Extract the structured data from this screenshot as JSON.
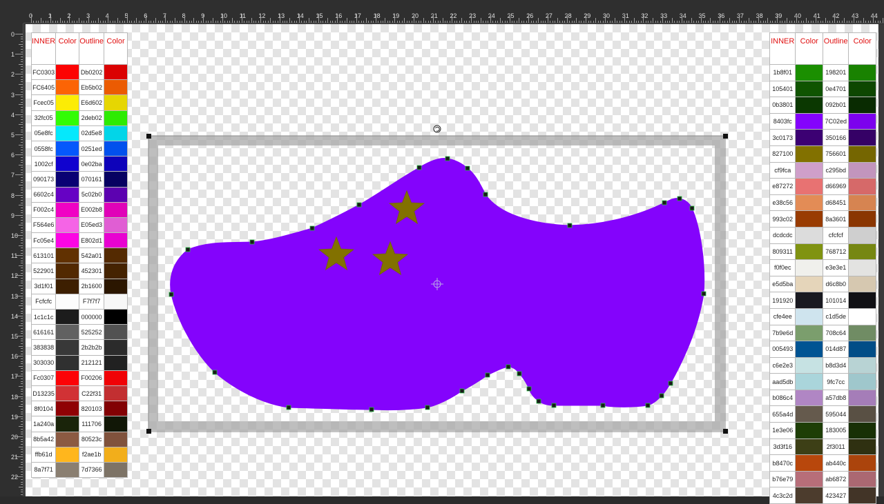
{
  "ruler": {
    "top_labels": [
      "0",
      "1",
      "2",
      "3",
      "4",
      "5",
      "6",
      "7",
      "8",
      "9",
      "10",
      "11",
      "12",
      "13",
      "14",
      "15",
      "16",
      "17",
      "18",
      "19",
      "20",
      "21",
      "22",
      "23",
      "24",
      "25",
      "26",
      "27",
      "28",
      "29",
      "30",
      "31",
      "32",
      "33",
      "34",
      "35",
      "36",
      "37",
      "38",
      "39",
      "40",
      "41",
      "42",
      "43",
      "44"
    ],
    "left_labels": [
      "0",
      "1",
      "2",
      "3",
      "4",
      "5",
      "6",
      "7",
      "8",
      "9",
      "10",
      "11",
      "12",
      "13",
      "14",
      "15",
      "16",
      "17",
      "18",
      "19",
      "20",
      "21",
      "22"
    ]
  },
  "palette_left": {
    "headers": [
      "INNER",
      "Color",
      "Outline",
      "Color"
    ],
    "rows": [
      {
        "inner": "FC0303",
        "inner_color": "#fc0303",
        "outline": "Db0202",
        "outline_color": "#db0202"
      },
      {
        "inner": "FC6405",
        "inner_color": "#fc6405",
        "outline": "Eb5b02",
        "outline_color": "#eb5b02"
      },
      {
        "inner": "Fcec05",
        "inner_color": "#fcec05",
        "outline": "E6d602",
        "outline_color": "#e6d602"
      },
      {
        "inner": "32fc05",
        "inner_color": "#32fc05",
        "outline": "2deb02",
        "outline_color": "#2deb02"
      },
      {
        "inner": "05e8fc",
        "inner_color": "#05e8fc",
        "outline": "02d5e8",
        "outline_color": "#02d5e8"
      },
      {
        "inner": "0558fc",
        "inner_color": "#0558fc",
        "outline": "0251ed",
        "outline_color": "#0251ed"
      },
      {
        "inner": "1002cf",
        "inner_color": "#1002cf",
        "outline": "0e02ba",
        "outline_color": "#0e02ba"
      },
      {
        "inner": "090173",
        "inner_color": "#090173",
        "outline": "070161",
        "outline_color": "#070161"
      },
      {
        "inner": "6602c4",
        "inner_color": "#6602c4",
        "outline": "5c02b0",
        "outline_color": "#5c02b0"
      },
      {
        "inner": "F002c4",
        "inner_color": "#f002c4",
        "outline": "E002b8",
        "outline_color": "#e002b8"
      },
      {
        "inner": "F564e6",
        "inner_color": "#f564e6",
        "outline": "E05ed3",
        "outline_color": "#e05ed3"
      },
      {
        "inner": "Fc05e4",
        "inner_color": "#fc05e4",
        "outline": "E802d1",
        "outline_color": "#e802d1"
      },
      {
        "inner": "613101",
        "inner_color": "#613101",
        "outline": "542a01",
        "outline_color": "#542a01"
      },
      {
        "inner": "522901",
        "inner_color": "#522901",
        "outline": "452301",
        "outline_color": "#452301"
      },
      {
        "inner": "3d1f01",
        "inner_color": "#3d1f01",
        "outline": "2b1600",
        "outline_color": "#2b1600"
      },
      {
        "inner": "Fcfcfc",
        "inner_color": "#fcfcfc",
        "outline": "F7f7f7",
        "outline_color": "#f7f7f7"
      },
      {
        "inner": "1c1c1c",
        "inner_color": "#1c1c1c",
        "outline": "000000",
        "outline_color": "#000000"
      },
      {
        "inner": "616161",
        "inner_color": "#616161",
        "outline": "525252",
        "outline_color": "#525252"
      },
      {
        "inner": "383838",
        "inner_color": "#383838",
        "outline": "2b2b2b",
        "outline_color": "#2b2b2b"
      },
      {
        "inner": "303030",
        "inner_color": "#303030",
        "outline": "212121",
        "outline_color": "#212121"
      },
      {
        "inner": "Fc0307",
        "inner_color": "#fc0307",
        "outline": "F00206",
        "outline_color": "#f00206"
      },
      {
        "inner": "D13235",
        "inner_color": "#d13235",
        "outline": "C22f31",
        "outline_color": "#c22f31"
      },
      {
        "inner": "8f0104",
        "inner_color": "#8f0104",
        "outline": "820103",
        "outline_color": "#820103"
      },
      {
        "inner": "1a240a",
        "inner_color": "#1a240a",
        "outline": "111706",
        "outline_color": "#111706"
      },
      {
        "inner": "8b5a42",
        "inner_color": "#8b5a42",
        "outline": "80523c",
        "outline_color": "#80523c"
      },
      {
        "inner": "ffb61d",
        "inner_color": "#ffb61d",
        "outline": "f2ae1b",
        "outline_color": "#f2ae1b"
      },
      {
        "inner": "8a7f71",
        "inner_color": "#8a7f71",
        "outline": "7d7366",
        "outline_color": "#7d7366"
      }
    ]
  },
  "palette_right": {
    "headers": [
      "INNER",
      "Color",
      "Outline",
      "Color"
    ],
    "rows": [
      {
        "inner": "1b8f01",
        "inner_color": "#1b8f01",
        "outline": "198201",
        "outline_color": "#198201"
      },
      {
        "inner": "105401",
        "inner_color": "#105401",
        "outline": "0e4701",
        "outline_color": "#0e4701"
      },
      {
        "inner": "0b3801",
        "inner_color": "#0b3801",
        "outline": "092b01",
        "outline_color": "#092b01"
      },
      {
        "inner": "8403fc",
        "inner_color": "#8403fc",
        "outline": "7C02ed",
        "outline_color": "#7c02ed"
      },
      {
        "inner": "3c0173",
        "inner_color": "#3c0173",
        "outline": "350166",
        "outline_color": "#350166"
      },
      {
        "inner": "827100",
        "inner_color": "#827100",
        "outline": "756601",
        "outline_color": "#756601"
      },
      {
        "inner": "cf9fca",
        "inner_color": "#cf9fca",
        "outline": "c295bd",
        "outline_color": "#c295bd"
      },
      {
        "inner": "e87272",
        "inner_color": "#e87272",
        "outline": "d66969",
        "outline_color": "#d66969"
      },
      {
        "inner": "e38c56",
        "inner_color": "#e38c56",
        "outline": "d68451",
        "outline_color": "#d68451"
      },
      {
        "inner": "993c02",
        "inner_color": "#993c02",
        "outline": "8a3601",
        "outline_color": "#8a3601"
      },
      {
        "inner": "dcdcdc",
        "inner_color": "#dcdcdc",
        "outline": "cfcfcf",
        "outline_color": "#cfcfcf"
      },
      {
        "inner": "809311",
        "inner_color": "#809311",
        "outline": "768712",
        "outline_color": "#768712"
      },
      {
        "inner": "f0f0ec",
        "inner_color": "#f0f0ec",
        "outline": "e3e3e1",
        "outline_color": "#e3e3e1"
      },
      {
        "inner": "e5d5ba",
        "inner_color": "#e5d5ba",
        "outline": "d6c8b0",
        "outline_color": "#d6c8b0"
      },
      {
        "inner": "191920",
        "inner_color": "#191920",
        "outline": "101014",
        "outline_color": "#101014"
      },
      {
        "inner": "cfe4ee",
        "inner_color": "#cfe4ee",
        "outline": "c1d5de",
        "outline_color": "#ffffff"
      },
      {
        "inner": "7b9e6d",
        "inner_color": "#7b9e6d",
        "outline": "708c64",
        "outline_color": "#708c64"
      },
      {
        "inner": "005493",
        "inner_color": "#005493",
        "outline": "014d87",
        "outline_color": "#014d87"
      },
      {
        "inner": "c6e2e3",
        "inner_color": "#c6e2e3",
        "outline": "b8d3d4",
        "outline_color": "#b8d3d4"
      },
      {
        "inner": "aad5db",
        "inner_color": "#aad5db",
        "outline": "9fc7cc",
        "outline_color": "#9fc7cc"
      },
      {
        "inner": "b086c4",
        "inner_color": "#b086c4",
        "outline": "a57db8",
        "outline_color": "#a57db8"
      },
      {
        "inner": "655a4d",
        "inner_color": "#655a4d",
        "outline": "595044",
        "outline_color": "#595044"
      },
      {
        "inner": "1e3e06",
        "inner_color": "#1e3e06",
        "outline": "183005",
        "outline_color": "#183005"
      },
      {
        "inner": "3d3f16",
        "inner_color": "#3d3f16",
        "outline": "2f3011",
        "outline_color": "#2f3011"
      },
      {
        "inner": "b8470c",
        "inner_color": "#b8470c",
        "outline": "ab440c",
        "outline_color": "#ab440c"
      },
      {
        "inner": "b76e79",
        "inner_color": "#b76e79",
        "outline": "ab6872",
        "outline_color": "#ab6872"
      },
      {
        "inner": "4c3c2d",
        "inner_color": "#4c3c2d",
        "outline": "423427",
        "outline_color": "#423427"
      }
    ]
  },
  "shape": {
    "fill_color": "#8403fc",
    "star_color": "#827100",
    "star_outline": "#756601",
    "node_color": "#1a1a1a"
  }
}
